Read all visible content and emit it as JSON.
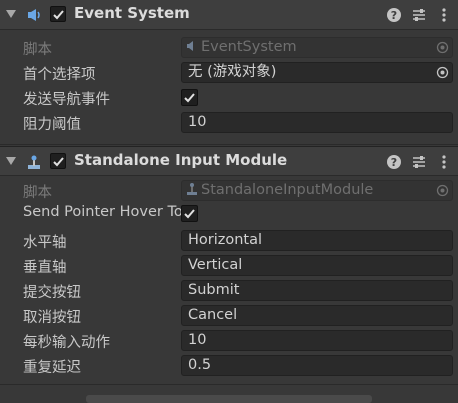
{
  "components": [
    {
      "title": "Event System",
      "script_label": "脚本",
      "script_value": "EventSystem",
      "fields": [
        {
          "label": "首个选择项",
          "value": "无 (游戏对象)"
        },
        {
          "label": "发送导航事件",
          "checked": true
        },
        {
          "label": "阻力阈值",
          "value": "10"
        }
      ]
    },
    {
      "title": "Standalone Input Module",
      "script_label": "脚本",
      "script_value": "StandaloneInputModule",
      "fields": [
        {
          "label": "Send Pointer Hover To Parent",
          "checked": true
        },
        {
          "label": "水平轴",
          "value": "Horizontal"
        },
        {
          "label": "垂直轴",
          "value": "Vertical"
        },
        {
          "label": "提交按钮",
          "value": "Submit"
        },
        {
          "label": "取消按钮",
          "value": "Cancel"
        },
        {
          "label": "每秒输入动作",
          "value": "10"
        },
        {
          "label": "重复延迟",
          "value": "0.5"
        }
      ]
    }
  ],
  "icons": {
    "component1": "event-system-icon",
    "component2": "input-module-icon",
    "help": "help-icon",
    "presets": "presets-icon",
    "menu": "kebab-menu-icon"
  },
  "colors": {
    "background": "#383838",
    "header": "#3e3e3e",
    "field": "#2a2a2a",
    "text": "#c8c8c8"
  }
}
